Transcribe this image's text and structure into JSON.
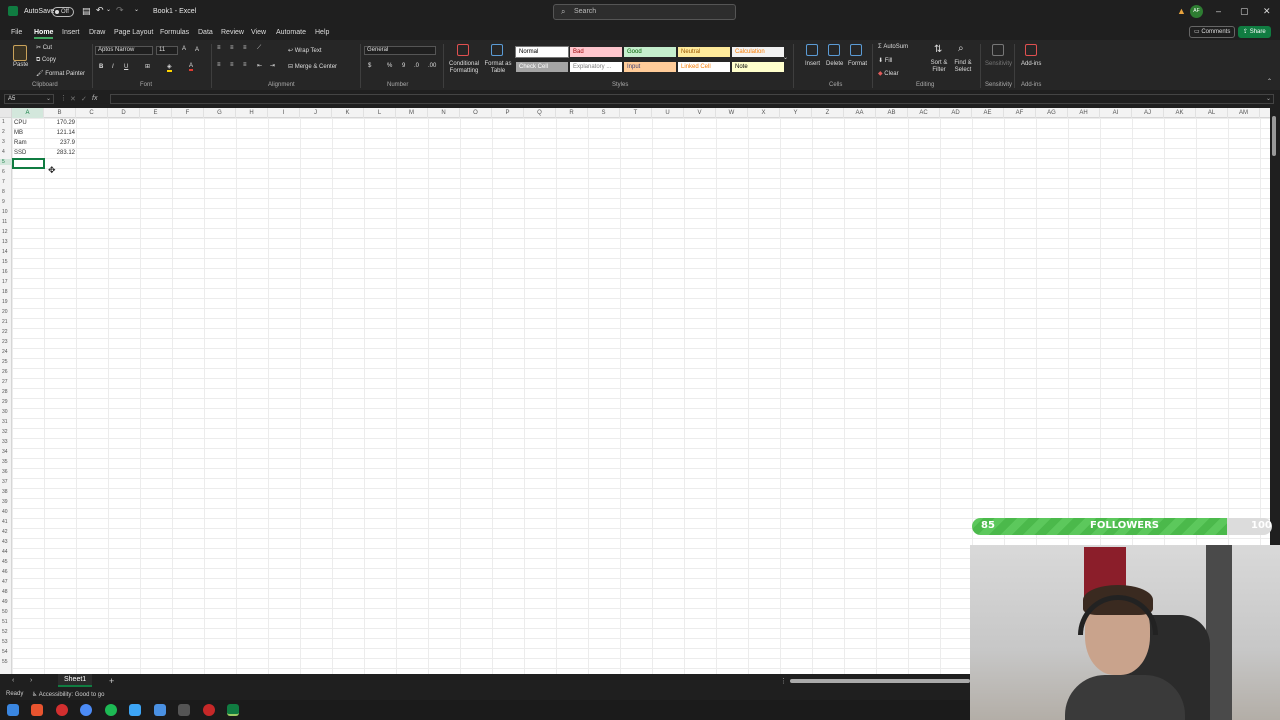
{
  "titlebar": {
    "autosave_label": "AutoSave",
    "autosave_state": "Off",
    "doc_title": "Book1 - Excel",
    "search_placeholder": "Search",
    "avatar_initials": "AF"
  },
  "menu": {
    "tabs": [
      "File",
      "Home",
      "Insert",
      "Draw",
      "Page Layout",
      "Formulas",
      "Data",
      "Review",
      "View",
      "Automate",
      "Help"
    ],
    "active": "Home",
    "comments_label": "Comments",
    "share_label": "Share"
  },
  "ribbon": {
    "clipboard": {
      "paste": "Paste",
      "cut": "Cut",
      "copy": "Copy",
      "format_painter": "Format Painter",
      "group": "Clipboard"
    },
    "font": {
      "name": "Aptos Narrow",
      "size": "11",
      "group": "Font"
    },
    "alignment": {
      "wrap_text": "Wrap Text",
      "merge_center": "Merge & Center",
      "group": "Alignment"
    },
    "number": {
      "format": "General",
      "group": "Number"
    },
    "styles": {
      "conditional": "Conditional Formatting",
      "format_table": "Format as Table",
      "cells": [
        {
          "label": "Normal",
          "bg": "#ffffff",
          "fg": "#000000"
        },
        {
          "label": "Bad",
          "bg": "#ffc7ce",
          "fg": "#9c0006"
        },
        {
          "label": "Good",
          "bg": "#c6efce",
          "fg": "#006100"
        },
        {
          "label": "Neutral",
          "bg": "#ffeb9c",
          "fg": "#9c5700"
        },
        {
          "label": "Calculation",
          "bg": "#f2f2f2",
          "fg": "#fa7d00"
        },
        {
          "label": "Check Cell",
          "bg": "#a5a5a5",
          "fg": "#ffffff"
        },
        {
          "label": "Explanatory ...",
          "bg": "#ffffff",
          "fg": "#7f7f7f"
        },
        {
          "label": "Input",
          "bg": "#ffcc99",
          "fg": "#3f3f76"
        },
        {
          "label": "Linked Cell",
          "bg": "#ffffff",
          "fg": "#fa7d00"
        },
        {
          "label": "Note",
          "bg": "#ffffcc",
          "fg": "#000000"
        }
      ],
      "group": "Styles"
    },
    "cells": {
      "insert": "Insert",
      "delete": "Delete",
      "format": "Format",
      "group": "Cells"
    },
    "editing": {
      "autosum": "AutoSum",
      "fill": "Fill",
      "clear": "Clear",
      "sort_filter": "Sort & Filter",
      "find_select": "Find & Select",
      "group": "Editing"
    },
    "sensitivity": {
      "label": "Sensitivity",
      "group": "Sensitivity"
    },
    "addins": {
      "label": "Add-ins",
      "group": "Add-ins"
    }
  },
  "formula_bar": {
    "name_box": "A5",
    "fx": "fx",
    "value": ""
  },
  "sheet": {
    "columns": [
      "A",
      "B",
      "C",
      "D",
      "E",
      "F",
      "G",
      "H",
      "I",
      "J",
      "K",
      "L",
      "M",
      "N",
      "O",
      "P",
      "Q",
      "R",
      "S",
      "T",
      "U",
      "V",
      "W",
      "X",
      "Y",
      "Z",
      "AA",
      "AB",
      "AC",
      "AD",
      "AE",
      "AF",
      "AG",
      "AH",
      "AI",
      "AJ",
      "AK",
      "AL",
      "AM"
    ],
    "row_count": 55,
    "cells": [
      {
        "row": 1,
        "a": "CPU",
        "b": "170.29"
      },
      {
        "row": 2,
        "a": "MB",
        "b": "121.14"
      },
      {
        "row": 3,
        "a": "Ram",
        "b": "237.9"
      },
      {
        "row": 4,
        "a": "SSD",
        "b": "283.12"
      }
    ],
    "selected": "A5",
    "tab_name": "Sheet1"
  },
  "status": {
    "ready": "Ready",
    "accessibility": "Accessibility: Good to go"
  },
  "overlay": {
    "followers_current": "85",
    "followers_label": "FOLLOWERS",
    "followers_goal": "100",
    "followers_fraction": 0.85
  },
  "colors": {
    "accent": "#107c41",
    "followers_fill": "#5cc85c"
  }
}
